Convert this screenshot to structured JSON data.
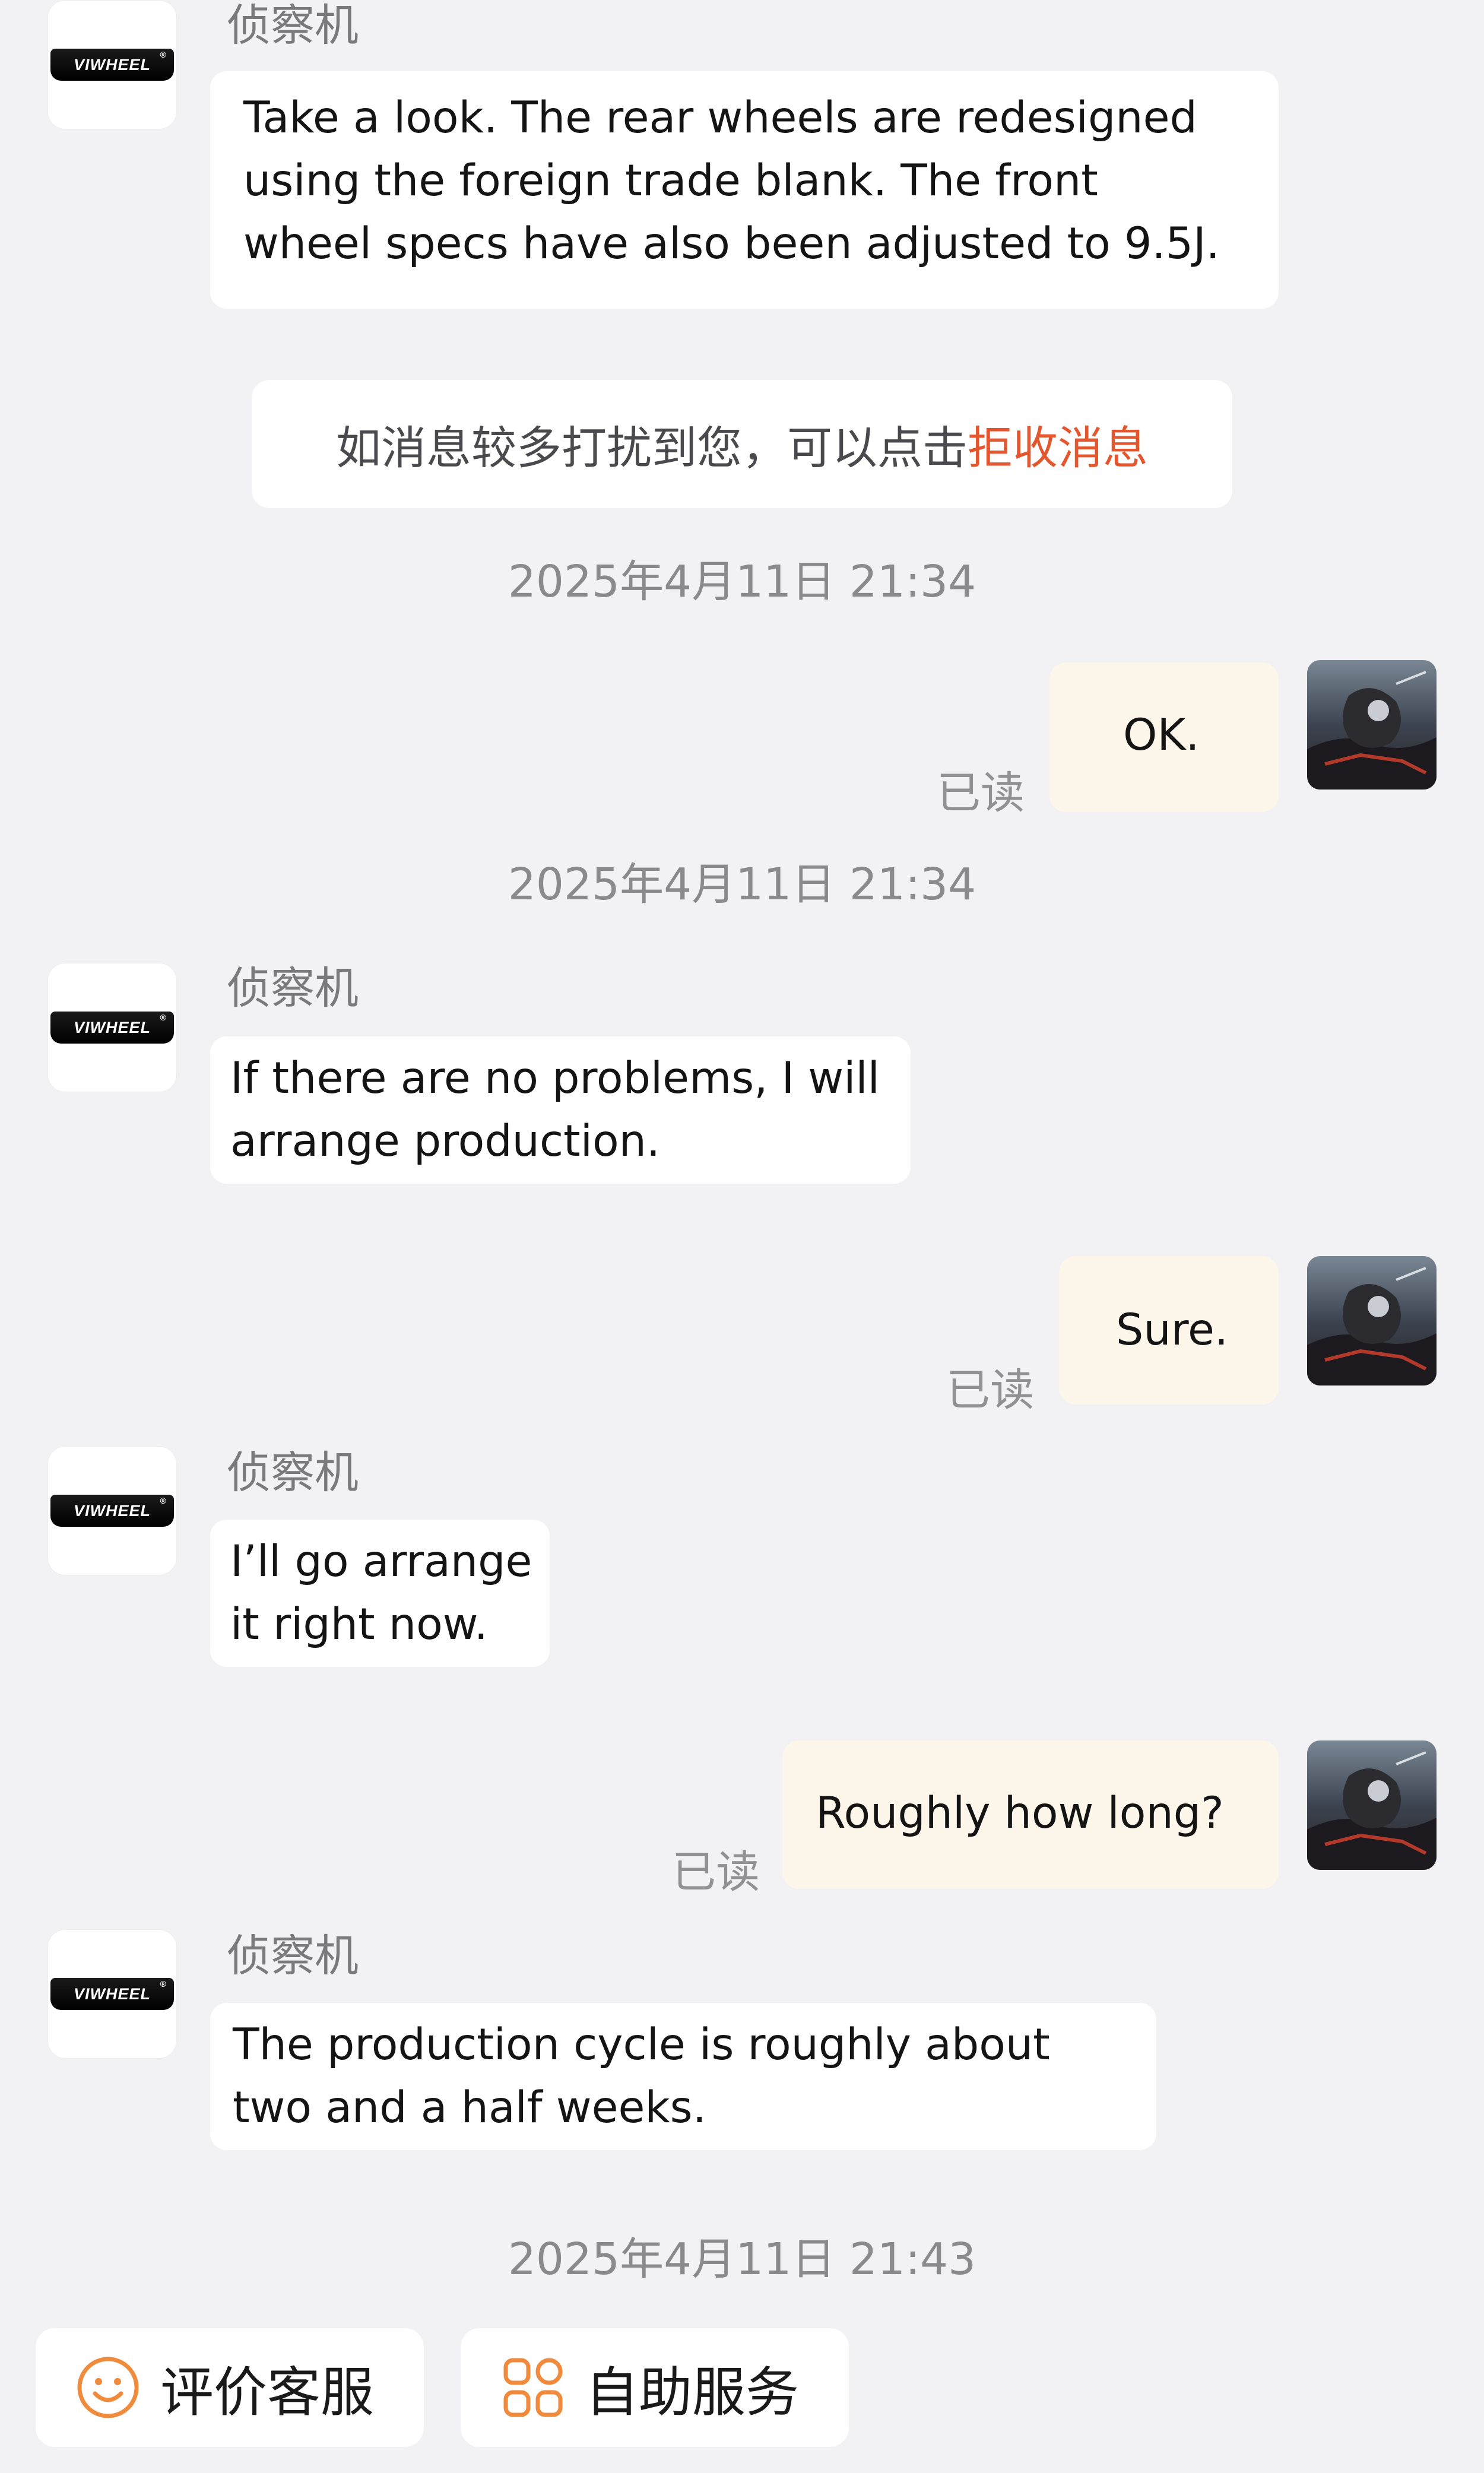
{
  "shop": {
    "name": "侦察机",
    "logo_text": "VIWHEEL",
    "logo_mark": "®"
  },
  "messages": [
    {
      "lines": [
        "Take a look. The rear wheels are redesigned",
        "using the foreign trade blank. The front",
        "wheel specs have also been adjusted to 9.5J."
      ]
    },
    {
      "lines": [
        "If there are no problems, I will",
        "arrange production."
      ]
    },
    {
      "lines": [
        "I’ll go arrange",
        "it right now."
      ]
    },
    {
      "lines": [
        "The production cycle is roughly about",
        "two and a half weeks."
      ]
    }
  ],
  "my_messages": [
    {
      "text": "OK.",
      "status": "已读"
    },
    {
      "text": "Sure.",
      "status": "已读"
    },
    {
      "text": "Roughly how long?",
      "status": "已读"
    }
  ],
  "notice": {
    "prefix": "如消息较多打扰到您，可以点击 ",
    "link": "拒收消息"
  },
  "timestamps": [
    "2025年4月11日 21:34",
    "2025年4月11日 21:34",
    "2025年4月11日 21:43"
  ],
  "actions": {
    "rate": {
      "label": "评价客服",
      "icon": "smiley-icon"
    },
    "self_service": {
      "label": "自助服务",
      "icon": "grid-apps-icon"
    }
  },
  "colors": {
    "background": "#f2f2f4",
    "bubble_other": "#ffffff",
    "bubble_me": "#fdf6ea",
    "accent_orange": "#e4572e"
  }
}
